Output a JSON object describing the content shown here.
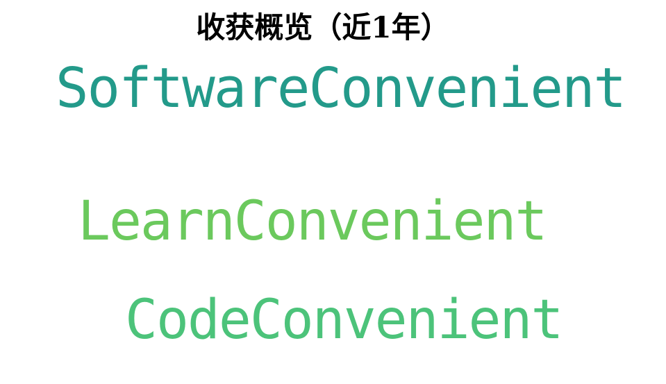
{
  "title": "收获概览（近1年）",
  "words": [
    {
      "text": "SoftwareConvenient",
      "color": "#239a8a"
    },
    {
      "text": "LearnConvenient",
      "color": "#6bc95d"
    },
    {
      "text": "CodeConvenient",
      "color": "#4cc37a"
    }
  ]
}
